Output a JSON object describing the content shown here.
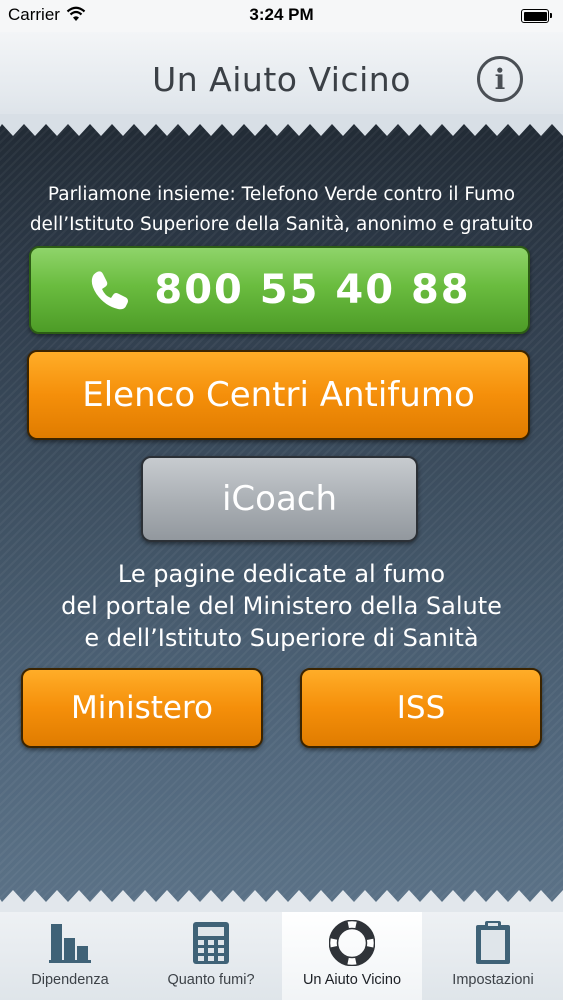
{
  "status_bar": {
    "carrier": "Carrier",
    "time": "3:24 PM"
  },
  "header": {
    "title": "Un Aiuto Vicino",
    "info_icon": "info-circle-icon"
  },
  "main": {
    "intro_line1": "Parliamone insieme: Telefono Verde contro il Fumo",
    "intro_line2": "dell’Istituto Superiore della Sanità, anonimo e gratuito",
    "phone_button": {
      "label": "800 55 40 88",
      "icon": "phone-icon"
    },
    "centri_button": "Elenco Centri Antifumo",
    "icoach_button": "iCoach",
    "portal_line1": "Le pagine dedicate al fumo",
    "portal_line2": "del portale del Ministero della Salute",
    "portal_line3": "e dell’Istituto Superiore di Sanità",
    "ministero_button": "Ministero",
    "iss_button": "ISS"
  },
  "tab_bar": {
    "tabs": [
      {
        "label": "Dipendenza",
        "icon": "bar-chart-icon",
        "active": false
      },
      {
        "label": "Quanto fumi?",
        "icon": "calculator-icon",
        "active": false
      },
      {
        "label": "Un Aiuto Vicino",
        "icon": "lifebuoy-icon",
        "active": true
      },
      {
        "label": "Impostazioni",
        "icon": "clipboard-icon",
        "active": false
      }
    ]
  },
  "colors": {
    "phone_green": "#6abc3f",
    "orange": "#f58f0a",
    "gray_button": "#a9aeb3",
    "panel_dark": "#2f3c4b"
  }
}
